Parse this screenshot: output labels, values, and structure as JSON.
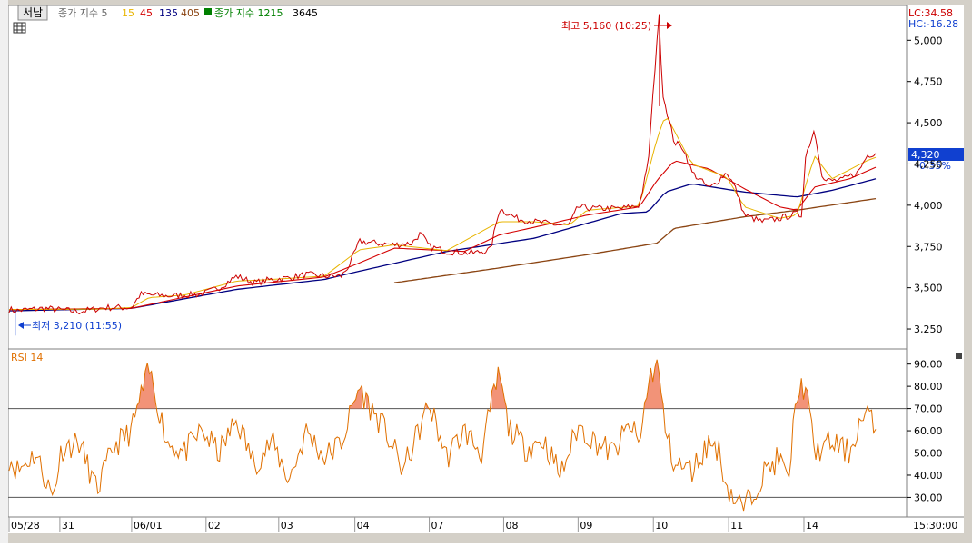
{
  "header": {
    "button_label": "서남",
    "indicator_main_label": "종가 지수 5",
    "ma_values": [
      {
        "value": "15",
        "color": "#e8b400"
      },
      {
        "value": "45",
        "color": "#d40000"
      },
      {
        "value": "135",
        "color": "#000080"
      },
      {
        "value": "405",
        "color": "#8b4513"
      }
    ],
    "indicator2_label": "종가 지수 1215",
    "indicator2_value": "3645",
    "indicator2_color": "#008000"
  },
  "right_panel": {
    "lc": "LC:34.58",
    "hc": "HC:-16.28",
    "price_badge": "4,320",
    "change_pct": "-0.35%",
    "time": "15:30:00"
  },
  "annotations": {
    "high": "최고 5,160 (10:25)",
    "low": "최저 3,210 (11:55)"
  },
  "rsi_label": "RSI 14",
  "colors": {
    "price": "#cc0000",
    "rsi": "#e07000",
    "rsi_fill": "#f08060",
    "badge": "#1040d0",
    "ma15": "#e8b400",
    "ma45": "#d40000",
    "ma135": "#000080",
    "ma405": "#8b4513"
  },
  "chart_data": [
    {
      "type": "line",
      "y_ticks": [
        "5,000",
        "4,750",
        "4,500",
        "4,250",
        "4,000",
        "3,750",
        "3,500",
        "3,250"
      ],
      "y_tick_values": [
        5000,
        4750,
        4500,
        4250,
        4000,
        3750,
        3500,
        3250
      ],
      "ylim": [
        3140,
        5200
      ],
      "x_labels": [
        "05/28",
        "31",
        "06/01",
        "02",
        "03",
        "04",
        "07",
        "08",
        "09",
        "10",
        "11",
        "14"
      ],
      "series_keypoints": {
        "price": [
          [
            0,
            3370
          ],
          [
            0.7,
            3360
          ],
          [
            4,
            3375
          ],
          [
            8,
            3355
          ],
          [
            11,
            3380
          ],
          [
            14,
            3380
          ],
          [
            15,
            3460
          ],
          [
            18,
            3450
          ],
          [
            22,
            3460
          ],
          [
            24,
            3500
          ],
          [
            26,
            3570
          ],
          [
            28,
            3530
          ],
          [
            30,
            3550
          ],
          [
            32,
            3560
          ],
          [
            34,
            3580
          ],
          [
            36,
            3570
          ],
          [
            38,
            3570
          ],
          [
            39,
            3650
          ],
          [
            40,
            3780
          ],
          [
            42,
            3770
          ],
          [
            44,
            3760
          ],
          [
            46,
            3770
          ],
          [
            47,
            3830
          ],
          [
            48,
            3750
          ],
          [
            50,
            3720
          ],
          [
            53,
            3710
          ],
          [
            55,
            3730
          ],
          [
            56,
            3980
          ],
          [
            58,
            3920
          ],
          [
            60,
            3900
          ],
          [
            63,
            3880
          ],
          [
            64,
            3880
          ],
          [
            65,
            3990
          ],
          [
            67,
            3980
          ],
          [
            70,
            3980
          ],
          [
            72,
            4000
          ],
          [
            73,
            4250
          ],
          [
            74,
            5000
          ],
          [
            74.3,
            5160
          ],
          [
            74.6,
            4700
          ],
          [
            75,
            4600
          ],
          [
            76,
            4380
          ],
          [
            77,
            4350
          ],
          [
            78,
            4200
          ],
          [
            80,
            4100
          ],
          [
            82,
            4200
          ],
          [
            83,
            4100
          ],
          [
            84,
            3940
          ],
          [
            86,
            3900
          ],
          [
            88,
            3920
          ],
          [
            90,
            3950
          ],
          [
            90.5,
            3930
          ],
          [
            91,
            4300
          ],
          [
            92,
            4460
          ],
          [
            93,
            4150
          ],
          [
            95,
            4150
          ],
          [
            97,
            4200
          ],
          [
            98,
            4300
          ],
          [
            99,
            4320
          ]
        ],
        "ma15": [
          [
            0,
            3368
          ],
          [
            10,
            3370
          ],
          [
            14,
            3380
          ],
          [
            16,
            3440
          ],
          [
            20,
            3455
          ],
          [
            26,
            3540
          ],
          [
            30,
            3550
          ],
          [
            36,
            3570
          ],
          [
            40,
            3730
          ],
          [
            44,
            3760
          ],
          [
            50,
            3725
          ],
          [
            56,
            3900
          ],
          [
            60,
            3900
          ],
          [
            64,
            3880
          ],
          [
            66,
            3970
          ],
          [
            72,
            3995
          ],
          [
            74,
            4400
          ],
          [
            75,
            4550
          ],
          [
            78,
            4250
          ],
          [
            82,
            4170
          ],
          [
            84,
            3990
          ],
          [
            88,
            3920
          ],
          [
            90,
            3940
          ],
          [
            92,
            4300
          ],
          [
            94,
            4160
          ],
          [
            98,
            4270
          ],
          [
            99,
            4290
          ]
        ],
        "ma45": [
          [
            0,
            3368
          ],
          [
            14,
            3375
          ],
          [
            18,
            3420
          ],
          [
            26,
            3510
          ],
          [
            36,
            3565
          ],
          [
            40,
            3650
          ],
          [
            44,
            3740
          ],
          [
            52,
            3720
          ],
          [
            56,
            3820
          ],
          [
            62,
            3890
          ],
          [
            66,
            3940
          ],
          [
            72,
            3990
          ],
          [
            74,
            4150
          ],
          [
            76,
            4270
          ],
          [
            80,
            4220
          ],
          [
            84,
            4100
          ],
          [
            88,
            3990
          ],
          [
            90,
            3970
          ],
          [
            92,
            4110
          ],
          [
            96,
            4160
          ],
          [
            99,
            4230
          ]
        ],
        "ma135": [
          [
            0,
            3360
          ],
          [
            14,
            3375
          ],
          [
            26,
            3490
          ],
          [
            36,
            3550
          ],
          [
            40,
            3600
          ],
          [
            50,
            3720
          ],
          [
            60,
            3800
          ],
          [
            70,
            3950
          ],
          [
            73,
            3960
          ],
          [
            75,
            4080
          ],
          [
            78,
            4130
          ],
          [
            84,
            4080
          ],
          [
            90,
            4050
          ],
          [
            94,
            4090
          ],
          [
            99,
            4160
          ]
        ],
        "ma405": [
          [
            44,
            3530
          ],
          [
            56,
            3620
          ],
          [
            66,
            3700
          ],
          [
            74,
            3770
          ],
          [
            76,
            3860
          ],
          [
            84,
            3930
          ],
          [
            90,
            3970
          ],
          [
            99,
            4040
          ]
        ]
      }
    },
    {
      "type": "line",
      "y_ticks": [
        "90.00",
        "80.00",
        "70.00",
        "60.00",
        "50.00",
        "40.00",
        "30.00"
      ],
      "y_tick_values": [
        90,
        80,
        70,
        60,
        50,
        40,
        30
      ],
      "ylim": [
        22,
        96
      ],
      "reference_lines": [
        70,
        30
      ],
      "series_keypoints": {
        "rsi": [
          [
            0,
            48
          ],
          [
            1,
            42
          ],
          [
            3,
            50
          ],
          [
            5,
            30
          ],
          [
            6,
            52
          ],
          [
            8,
            55
          ],
          [
            10,
            33
          ],
          [
            12,
            53
          ],
          [
            14,
            60
          ],
          [
            15,
            75
          ],
          [
            16,
            87
          ],
          [
            17,
            72
          ],
          [
            18,
            55
          ],
          [
            20,
            50
          ],
          [
            22,
            60
          ],
          [
            24,
            50
          ],
          [
            26,
            65
          ],
          [
            28,
            45
          ],
          [
            30,
            55
          ],
          [
            32,
            38
          ],
          [
            34,
            60
          ],
          [
            36,
            48
          ],
          [
            38,
            55
          ],
          [
            40,
            80
          ],
          [
            41,
            72
          ],
          [
            43,
            60
          ],
          [
            45,
            42
          ],
          [
            47,
            62
          ],
          [
            48,
            72
          ],
          [
            50,
            48
          ],
          [
            52,
            60
          ],
          [
            54,
            50
          ],
          [
            55,
            70
          ],
          [
            56,
            86
          ],
          [
            57,
            62
          ],
          [
            59,
            52
          ],
          [
            61,
            56
          ],
          [
            63,
            40
          ],
          [
            65,
            62
          ],
          [
            67,
            55
          ],
          [
            69,
            50
          ],
          [
            71,
            63
          ],
          [
            72,
            53
          ],
          [
            73,
            82
          ],
          [
            74,
            91
          ],
          [
            75,
            60
          ],
          [
            76,
            45
          ],
          [
            78,
            42
          ],
          [
            80,
            55
          ],
          [
            81,
            52
          ],
          [
            82,
            35
          ],
          [
            83,
            28
          ],
          [
            84,
            25
          ],
          [
            86,
            40
          ],
          [
            88,
            48
          ],
          [
            89,
            36
          ],
          [
            90,
            78
          ],
          [
            91,
            80
          ],
          [
            92,
            50
          ],
          [
            94,
            55
          ],
          [
            96,
            50
          ],
          [
            97,
            62
          ],
          [
            98,
            68
          ],
          [
            99,
            60
          ]
        ]
      }
    }
  ]
}
